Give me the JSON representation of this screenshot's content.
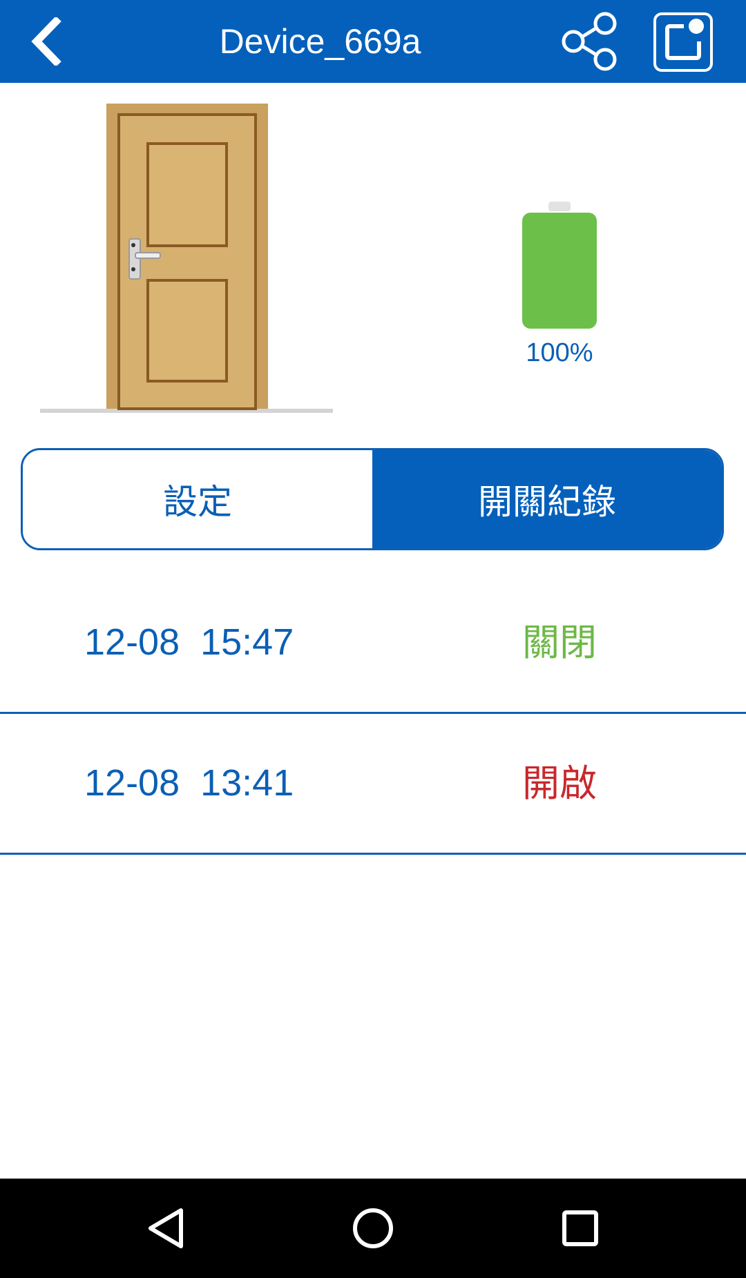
{
  "header": {
    "title": "Device_669a",
    "back_icon": "back-chevron-icon",
    "share_icon": "share-icon",
    "edit_icon": "edit-icon",
    "background_color": "#0560bb"
  },
  "device": {
    "image_icon": "door-icon",
    "battery_icon": "battery-icon",
    "battery_level": "100%",
    "battery_fill": 1.0,
    "battery_color": "#6cc04a"
  },
  "tabs": [
    {
      "label": "設定",
      "active": false
    },
    {
      "label": "開關紀錄",
      "active": true
    }
  ],
  "records": [
    {
      "time": "12-08  15:47",
      "state": "關閉",
      "state_color": "#6cb846"
    },
    {
      "time": "12-08  13:41",
      "state": "開啟",
      "state_color": "#c8282c"
    }
  ],
  "navbar": {
    "back_icon": "nav-back-icon",
    "home_icon": "nav-home-icon",
    "recents_icon": "nav-recents-icon"
  }
}
